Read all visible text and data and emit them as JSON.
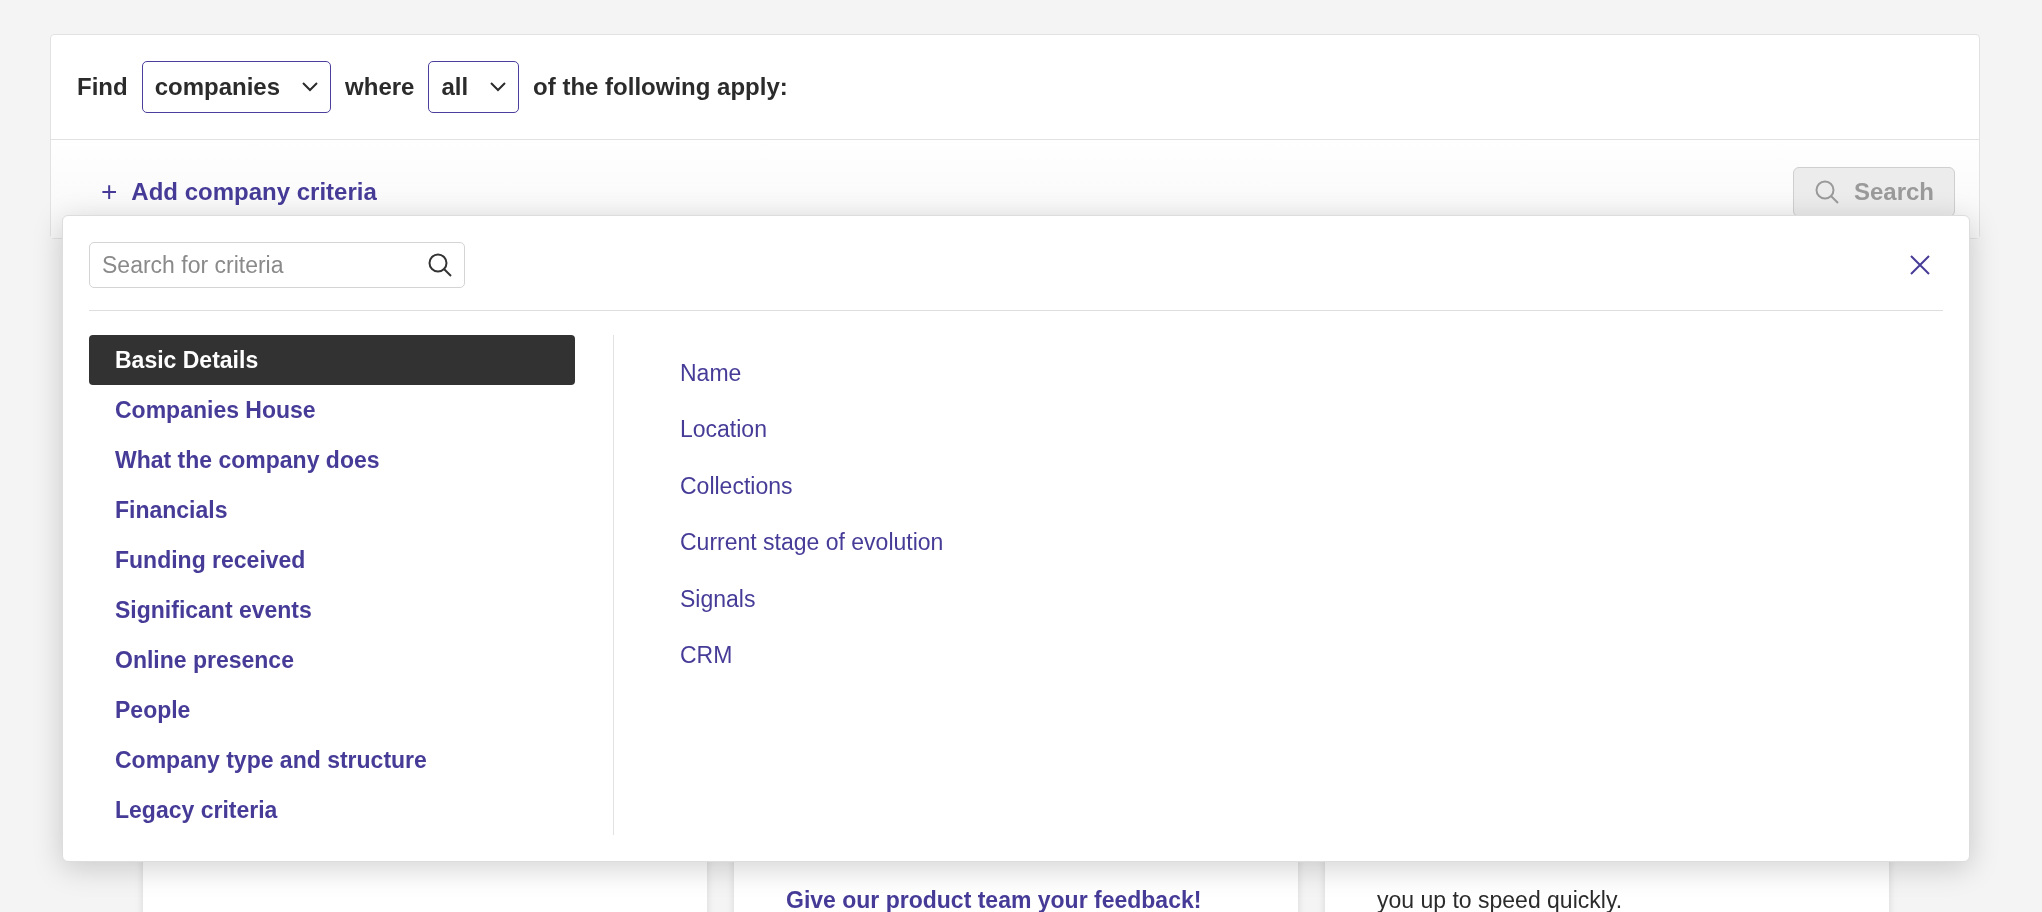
{
  "query_bar": {
    "find_label": "Find",
    "entity_select": {
      "value": "companies"
    },
    "where_label": "where",
    "match_select": {
      "value": "all"
    },
    "suffix": "of the following apply:"
  },
  "add_criteria": {
    "icon": "+",
    "label": "Add company criteria"
  },
  "search_button": {
    "label": "Search",
    "disabled": true
  },
  "criteria_popup": {
    "search": {
      "placeholder": "Search for criteria"
    },
    "categories": [
      {
        "label": "Basic Details",
        "selected": true
      },
      {
        "label": "Companies House",
        "selected": false
      },
      {
        "label": "What the company does",
        "selected": false
      },
      {
        "label": "Financials",
        "selected": false
      },
      {
        "label": "Funding received",
        "selected": false
      },
      {
        "label": "Significant events",
        "selected": false
      },
      {
        "label": "Online presence",
        "selected": false
      },
      {
        "label": "People",
        "selected": false
      },
      {
        "label": "Company type and structure",
        "selected": false
      },
      {
        "label": "Legacy criteria",
        "selected": false
      }
    ],
    "criteria": [
      "Name",
      "Location",
      "Collections",
      "Current stage of evolution",
      "Signals",
      "CRM"
    ]
  },
  "cards": [
    {
      "kind": "blank"
    },
    {
      "kind": "text",
      "lines": [
        {
          "text": "Give our product team your feedback!",
          "kind": "link"
        }
      ]
    },
    {
      "kind": "text",
      "lines": [
        {
          "text": "you up to speed quickly.",
          "kind": "text"
        }
      ]
    }
  ]
}
